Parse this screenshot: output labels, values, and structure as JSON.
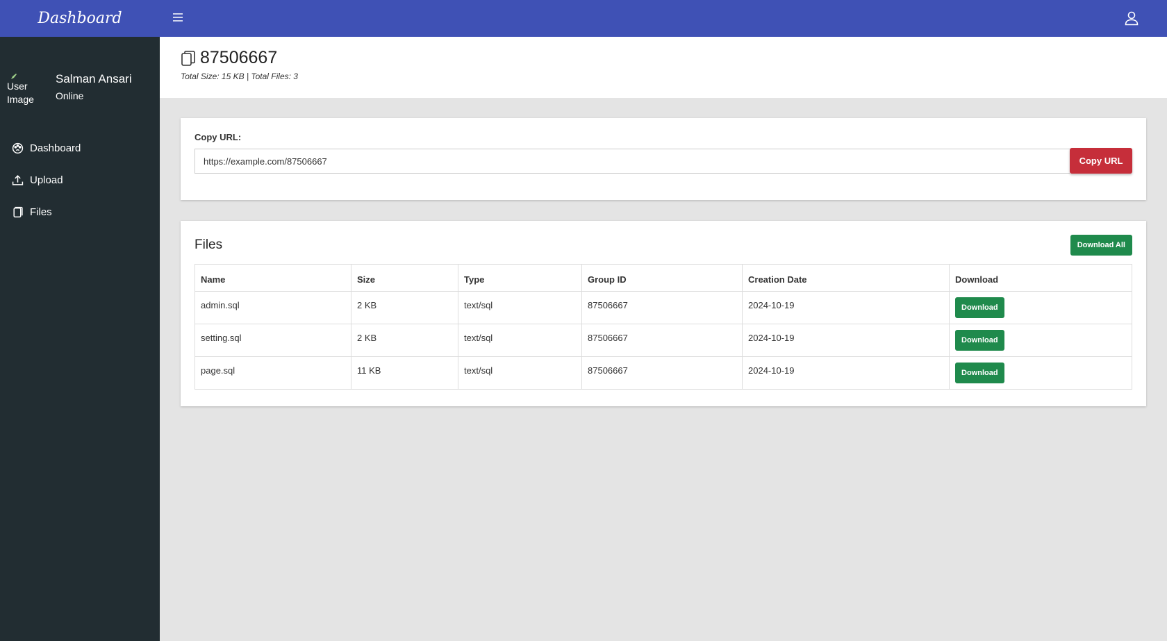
{
  "sidebar": {
    "brand": "Dashboard",
    "user": {
      "image_alt": "User Image",
      "name": "Salman Ansari",
      "status": "Online"
    },
    "items": [
      {
        "label": "Dashboard",
        "icon": "palette-icon"
      },
      {
        "label": "Upload",
        "icon": "upload-icon"
      },
      {
        "label": "Files",
        "icon": "file-icon"
      }
    ]
  },
  "header": {
    "title": "87506667",
    "subtitle": "Total Size: 15 KB | Total Files: 3"
  },
  "url_card": {
    "label": "Copy URL:",
    "url": "https://example.com/87506667",
    "copy_label": "Copy URL"
  },
  "files": {
    "title": "Files",
    "download_all_label": "Download All",
    "columns": [
      "Name",
      "Size",
      "Type",
      "Group ID",
      "Creation Date",
      "Download"
    ],
    "rows": [
      {
        "name": "admin.sql",
        "size": "2 KB",
        "type": "text/sql",
        "group_id": "87506667",
        "date": "2024-10-19",
        "action": "Download"
      },
      {
        "name": "setting.sql",
        "size": "2 KB",
        "type": "text/sql",
        "group_id": "87506667",
        "date": "2024-10-19",
        "action": "Download"
      },
      {
        "name": "page.sql",
        "size": "11 KB",
        "type": "text/sql",
        "group_id": "87506667",
        "date": "2024-10-19",
        "action": "Download"
      }
    ]
  },
  "colors": {
    "topbar": "#3f51b5",
    "sidebar": "#222d32",
    "copy_button": "#c62e3a",
    "download_button": "#1f8a4c"
  }
}
